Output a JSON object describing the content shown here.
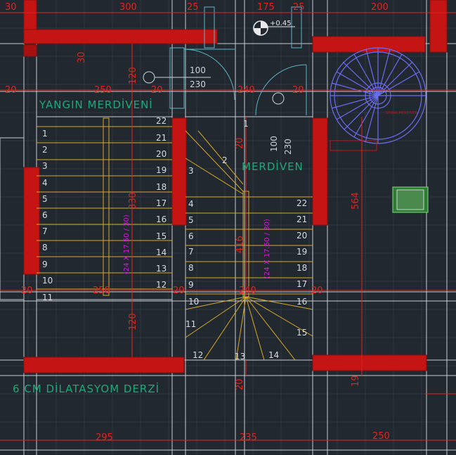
{
  "labels": {
    "fire_stair": "YANGIN MERDİVENİ",
    "stair": "MERDİVEN",
    "joint": "6 CM DİLATASYOM DERZİ",
    "level": "+0.45",
    "door_top": "100",
    "door_bottom": "230",
    "door2_left": "100",
    "door2_right": "230",
    "step_spec": "(24 X 17.50 / 30)",
    "spiral_note": "SPIRAL MERDIVEN"
  },
  "dims_top": [
    "30",
    "300",
    "25",
    "175",
    "25",
    "200"
  ],
  "dims_row2": [
    "20",
    "250",
    "20",
    "240",
    "20"
  ],
  "dims_row3": [
    "20",
    "250",
    "20",
    "240",
    "20"
  ],
  "dims_bottom": [
    "295",
    "235",
    "250"
  ],
  "dims_vertical": {
    "left_30": "30",
    "left_120_top": "120",
    "left_330": "330",
    "left_120_bottom": "120",
    "mid_20": "20",
    "mid_416": "416",
    "mid_20_bottom": "20",
    "right_564": "564",
    "right_19": "19"
  },
  "left_stair_numbers": [
    "1",
    "2",
    "3",
    "4",
    "5",
    "6",
    "7",
    "8",
    "9",
    "10",
    "11"
  ],
  "left_stair_numbers_right": [
    "22",
    "21",
    "20",
    "19",
    "18",
    "17",
    "16",
    "15",
    "14",
    "13",
    "12"
  ],
  "right_stair_left": [
    "3",
    "4",
    "5",
    "6",
    "7",
    "8",
    "9",
    "10",
    "11",
    "12"
  ],
  "right_stair_right": [
    "22",
    "21",
    "20",
    "19",
    "18",
    "17",
    "16",
    "15"
  ],
  "winder_top": [
    "1",
    "2"
  ],
  "winder_bottom": [
    "13",
    "14"
  ]
}
